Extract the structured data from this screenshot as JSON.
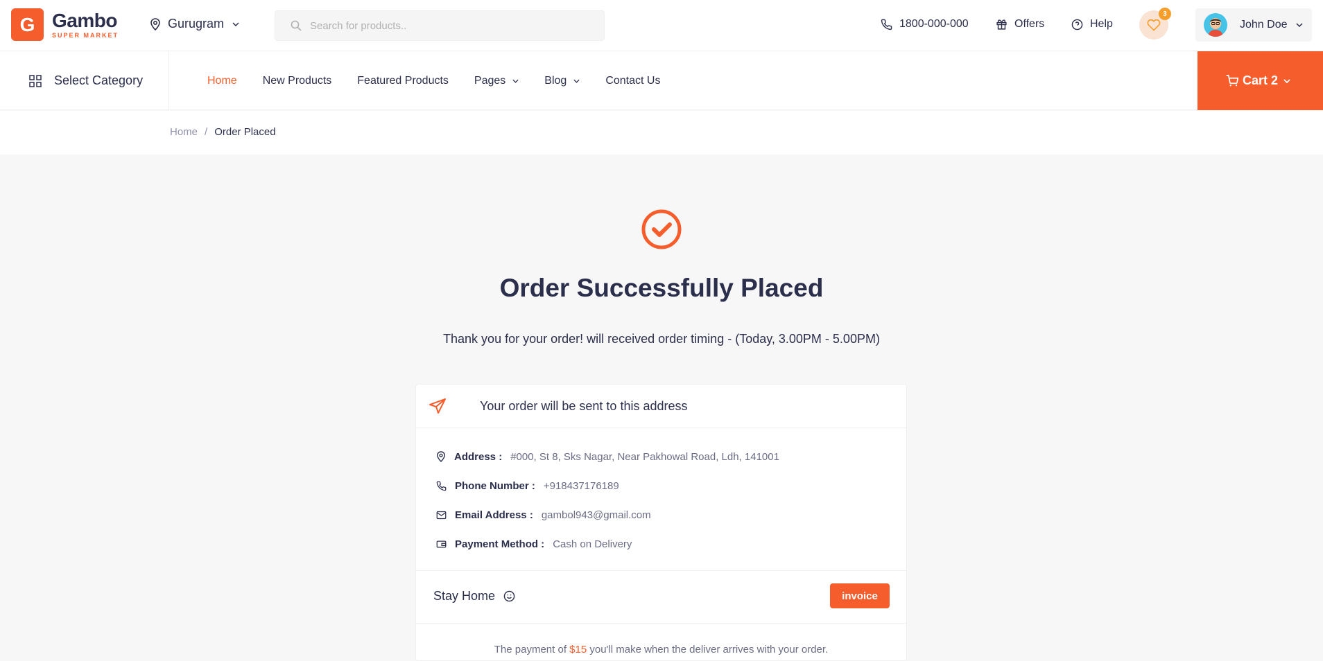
{
  "brand": {
    "name": "Gambo",
    "tagline": "SUPER MARKET",
    "letter": "G"
  },
  "location": {
    "city": "Gurugram"
  },
  "search": {
    "placeholder": "Search for products.."
  },
  "header": {
    "phone": "1800-000-000",
    "offers_label": "Offers",
    "help_label": "Help",
    "wishlist_count": "3",
    "user_name": "John Doe"
  },
  "nav": {
    "category_label": "Select Category",
    "links": [
      {
        "label": "Home",
        "active": true
      },
      {
        "label": "New Products"
      },
      {
        "label": "Featured Products"
      },
      {
        "label": "Pages"
      },
      {
        "label": "Blog"
      },
      {
        "label": "Contact Us"
      }
    ],
    "cart_label": "Cart 2"
  },
  "breadcrumb": {
    "home": "Home",
    "separator": "/",
    "current": "Order Placed"
  },
  "order": {
    "title": "Order Successfully Placed",
    "subtitle": "Thank you for your order! will received order timing - (Today, 3.00PM - 5.00PM)",
    "address_heading": "Your order will be sent to this address",
    "details": [
      {
        "label": "Address :",
        "value": "#000, St 8, Sks Nagar, Near Pakhowal Road, Ldh, 141001",
        "icon": "map-pin-icon"
      },
      {
        "label": "Phone Number :",
        "value": "+918437176189",
        "icon": "phone-icon"
      },
      {
        "label": "Email Address :",
        "value": "gambol943@gmail.com",
        "icon": "mail-icon"
      },
      {
        "label": "Payment Method :",
        "value": "Cash on Delivery",
        "icon": "wallet-icon"
      }
    ],
    "stay_label": "Stay Home",
    "invoice_label": "invoice",
    "payment_prefix": "The payment of",
    "payment_amount": "$15",
    "payment_suffix": "you'll make when the deliver arrives with your order."
  },
  "colors": {
    "accent": "#f55d2c",
    "dark": "#2b2f4c",
    "muted": "#6a6c83"
  }
}
